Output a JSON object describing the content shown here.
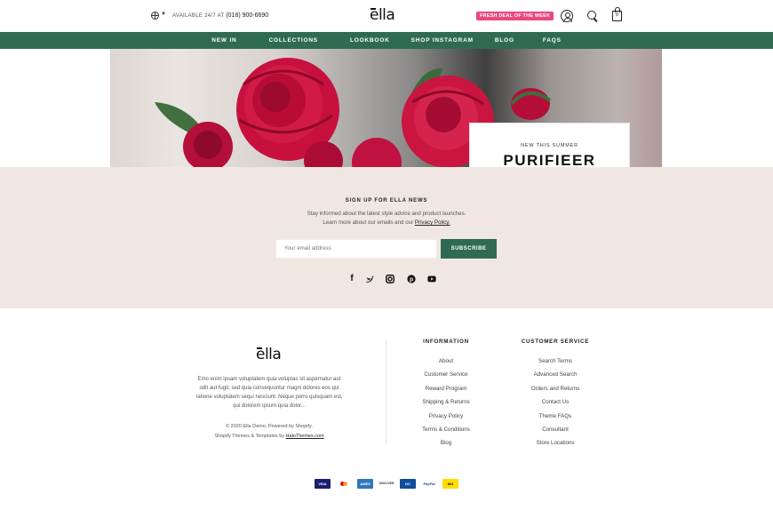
{
  "header": {
    "availability": "AVAILABLE 24/7 AT",
    "phone": "(018) 900-6690",
    "logo": "ella",
    "deal_badge": "FRESH DEAL OF THE WEEK",
    "cart_count": "0"
  },
  "nav": {
    "items": [
      {
        "label": "NEW IN"
      },
      {
        "label": "COLLECTIONS"
      },
      {
        "label": "LOOKBOOK"
      },
      {
        "label": "SHOP INSTAGRAM"
      },
      {
        "label": "BLOG"
      },
      {
        "label": "FAQS"
      }
    ]
  },
  "hero": {
    "kicker": "NEW THIS SUMMER",
    "title": "PURIFIEER"
  },
  "newsletter": {
    "title": "SIGN UP FOR ELLA NEWS",
    "line1": "Stay informed about the latest style advice and product launches.",
    "line2": "Learn more about our emails and our",
    "privacy_link": "Privacy Policy.",
    "email_placeholder": "Your email address",
    "subscribe_label": "SUBSCRIBE",
    "social_icons": [
      "facebook-icon",
      "twitter-icon",
      "instagram-icon",
      "pinterest-icon",
      "youtube-icon"
    ]
  },
  "footer": {
    "logo": "ella",
    "description": "Emo enim ipsam voluptatem quia voluptas sit aspernatur aut odit aut fugit, sed quia consequuntur magni dolores eos qui ratione voluptatem sequi nesciunt. Neque porro quisquam est, qui dolorem ipsum quia dolor...",
    "copyright": "© 2020 Ella Demo. Powered by Shopify.",
    "credits_prefix": "Shopify Themes & Templates by",
    "credits_link": "HaloThemes.com",
    "information": {
      "title": "INFORMATION",
      "links": [
        "About",
        "Customer Service",
        "Reward Program",
        "Shipping & Returns",
        "Privacy Policy",
        "Terms & Conditions",
        "Blog"
      ]
    },
    "customer_service": {
      "title": "CUSTOMER SERVICE",
      "links": [
        "Search Terms",
        "Advanced Search",
        "Orders and Returns",
        "Contact Us",
        "Theme FAQs",
        "Consultant",
        "Store Locations"
      ]
    },
    "payments": [
      {
        "label": "VISA",
        "color": "#1a1f71"
      },
      {
        "label": "MC",
        "color": "#ffffff"
      },
      {
        "label": "AMEX",
        "color": "#2e77bb"
      },
      {
        "label": "DISCOVER",
        "color": "#ffffff"
      },
      {
        "label": "DC",
        "color": "#0f4c99"
      },
      {
        "label": "PayPal",
        "color": "#ffffff"
      },
      {
        "label": "WU",
        "color": "#ffdd00"
      }
    ]
  }
}
